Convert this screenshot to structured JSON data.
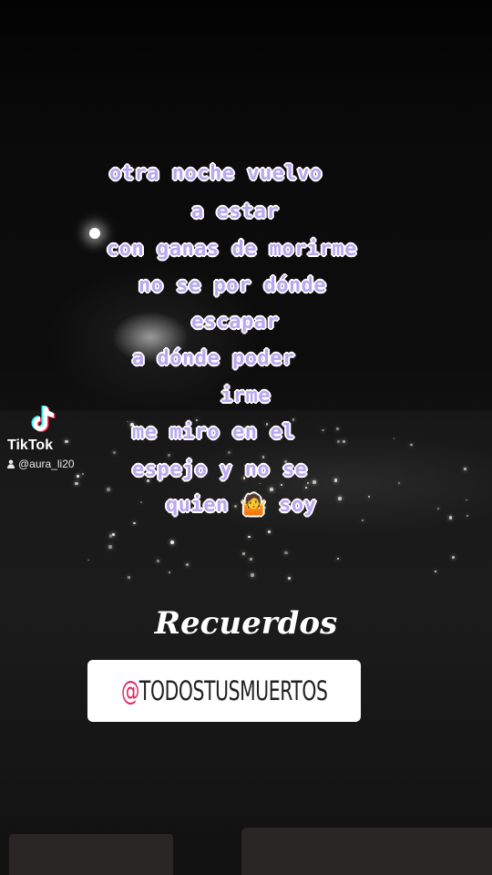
{
  "lyrics": [
    "otra noche vuelvo",
    "a estar",
    "con ganas de morirme",
    "no se por dónde",
    "escapar",
    "a dónde poder",
    "irme",
    "me miro en el",
    "espejo y no se",
    "quien 🤷 soy"
  ],
  "watermark": {
    "brand": "TikTok",
    "username": "@aura_li20",
    "logo_icon": "tiktok-note-icon"
  },
  "caption": "Recuerdos",
  "handle": {
    "at": "@",
    "name": "TODOSTUSMUERTOS"
  },
  "colors": {
    "lyric_fill": "#b8a8f0",
    "lyric_outline": "#ffffff",
    "handle_at": "#e0245e"
  }
}
